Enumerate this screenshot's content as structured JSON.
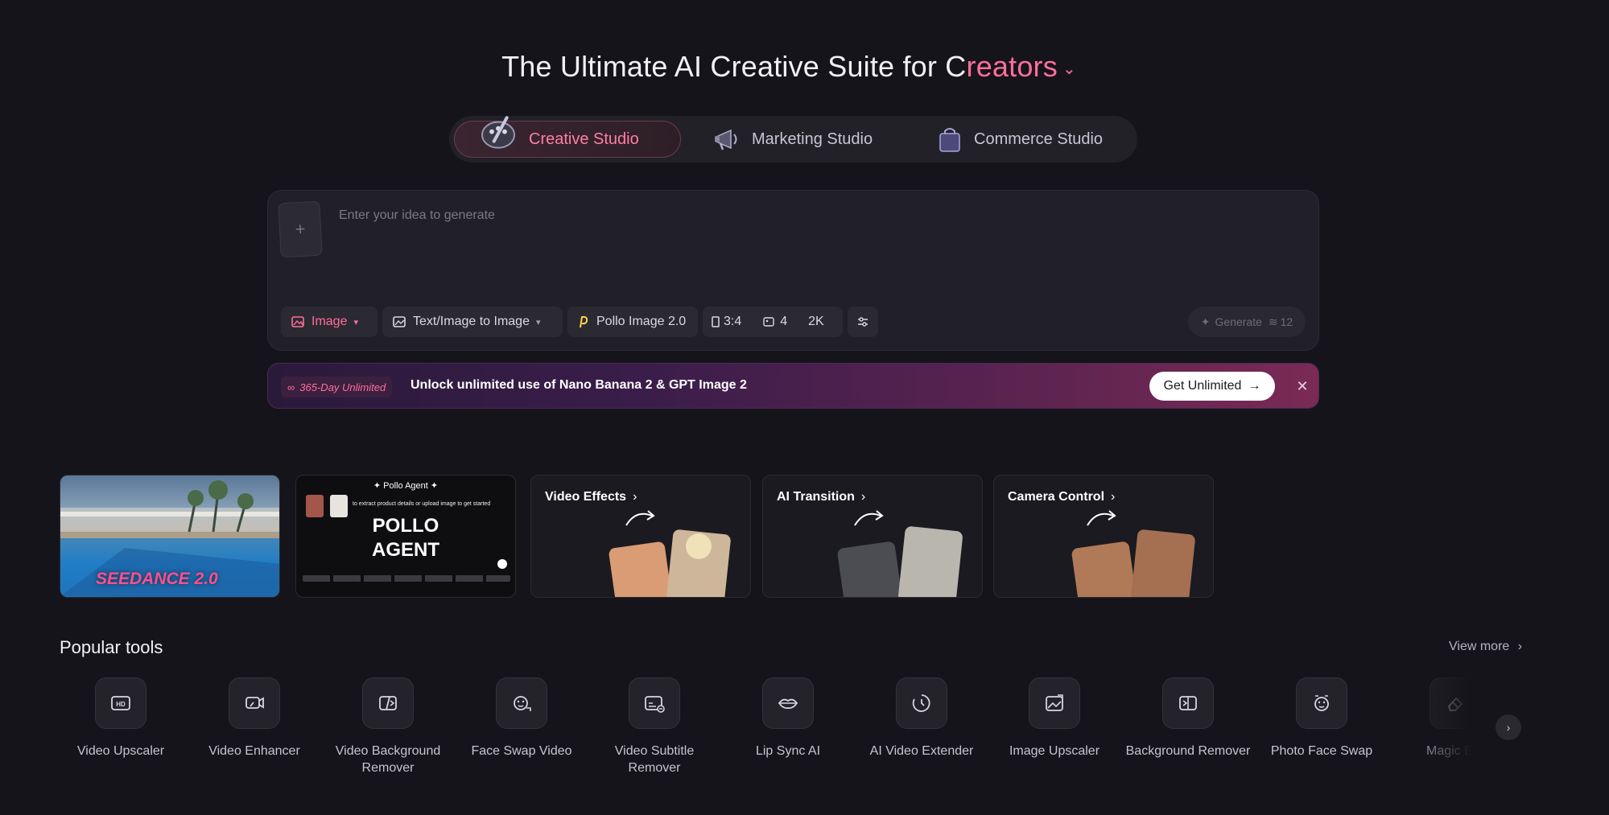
{
  "headline": {
    "prefix": "The Ultimate AI Creative Suite for C",
    "accent": "reators"
  },
  "studio_tabs": [
    {
      "label": "Creative Studio"
    },
    {
      "label": "Marketing Studio"
    },
    {
      "label": "Commerce Studio"
    }
  ],
  "prompt": {
    "placeholder": "Enter your idea to generate",
    "chips": {
      "type": "Image",
      "mode": "Text/Image to Image",
      "model": "Pollo Image 2.0",
      "ratio": "3:4",
      "count": "4",
      "resolution": "2K"
    },
    "generate_label": "Generate",
    "generate_cost": "12"
  },
  "banner": {
    "tag": "365-Day Unlimited",
    "text": "Unlock unlimited use of Nano Banana 2 & GPT Image 2",
    "button": "Get Unlimited"
  },
  "cards": [
    {
      "overlay": "SEEDANCE 2.0"
    },
    {
      "header": "Pollo Agent",
      "big": "POLLO AGENT",
      "note": "to extract product details or upload image to get started"
    },
    {
      "title": "Video Effects"
    },
    {
      "title": "AI Transition"
    },
    {
      "title": "Camera Control"
    }
  ],
  "popular_tools": {
    "title": "Popular tools",
    "view_more": "View more",
    "items": [
      {
        "label": "Video Upscaler",
        "icon": "hd-icon"
      },
      {
        "label": "Video Enhancer",
        "icon": "video-enhance-icon"
      },
      {
        "label": "Video Background Remover",
        "icon": "bg-remove-icon"
      },
      {
        "label": "Face Swap Video",
        "icon": "face-swap-icon"
      },
      {
        "label": "Video Subtitle Remover",
        "icon": "subtitle-icon"
      },
      {
        "label": "Lip Sync AI",
        "icon": "lips-icon"
      },
      {
        "label": "AI Video Extender",
        "icon": "extend-icon"
      },
      {
        "label": "Image Upscaler",
        "icon": "image-upscale-icon"
      },
      {
        "label": "Background Remover",
        "icon": "bg-remover-icon"
      },
      {
        "label": "Photo Face Swap",
        "icon": "photo-face-icon"
      },
      {
        "label": "Magic Era",
        "icon": "eraser-icon"
      }
    ]
  }
}
